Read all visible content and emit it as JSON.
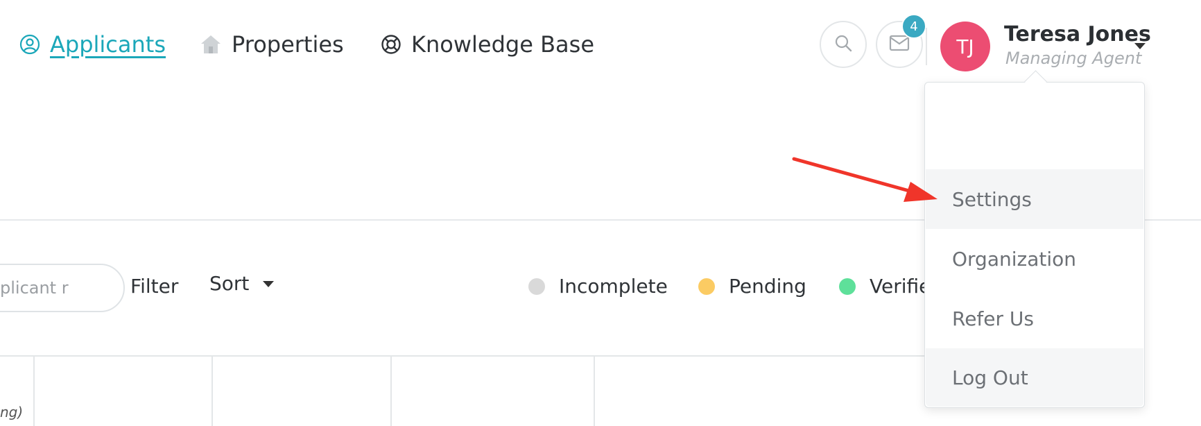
{
  "nav": {
    "applicants": "Applicants",
    "properties": "Properties",
    "knowledge_base": "Knowledge Base"
  },
  "header": {
    "notifications_count": "4",
    "avatar_initials": "TJ",
    "user_name": "Teresa Jones",
    "user_role": "Managing Agent"
  },
  "toolbar": {
    "search_placeholder": "plicant r",
    "filter_label": "Filter",
    "sort_label": "Sort"
  },
  "legend": [
    {
      "label": "Incomplete",
      "color": "#d9d9d9"
    },
    {
      "label": "Pending",
      "color": "#fbcb63"
    },
    {
      "label": "Verifie",
      "color": "#5ee09a"
    }
  ],
  "table": {
    "row_fragment": "ng)"
  },
  "user_menu": {
    "items": [
      "Settings",
      "Organization",
      "Refer Us",
      "Log Out"
    ]
  },
  "colors": {
    "accent": "#1ba7b9",
    "avatar": "#ec4d72",
    "badge": "#3aa9c2",
    "annotation_arrow": "#f0352a"
  }
}
